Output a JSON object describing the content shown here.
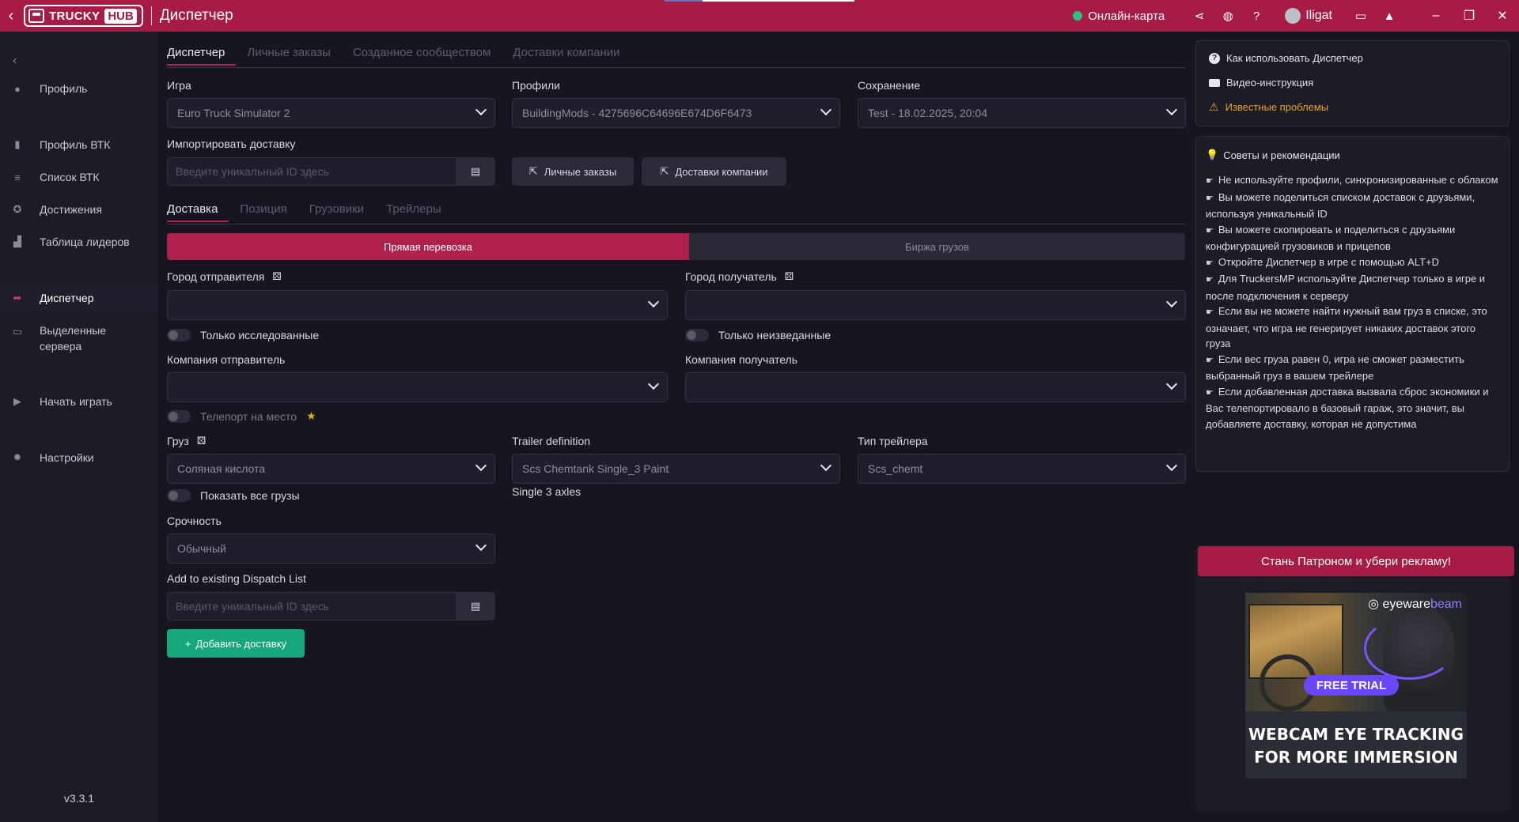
{
  "titlebar": {
    "brand_left": "TRUCKY",
    "brand_right": "HUB",
    "title": "Диспетчер",
    "online_label": "Онлайн-карта",
    "username": "Iligat"
  },
  "sidebar": {
    "items": [
      {
        "label": "Профиль",
        "icon": "user-icon"
      },
      {
        "label": "Профиль ВТК",
        "icon": "building-icon"
      },
      {
        "label": "Список ВТК",
        "icon": "database-icon"
      },
      {
        "label": "Достижения",
        "icon": "medal-icon"
      },
      {
        "label": "Таблица лидеров",
        "icon": "ranking-icon"
      },
      {
        "label": "Диспетчер",
        "icon": "dispatch-icon"
      },
      {
        "label": "Выделенные сервера",
        "icon": "server-icon"
      },
      {
        "label": "Начать играть",
        "icon": "play-icon"
      },
      {
        "label": "Настройки",
        "icon": "gear-icon"
      }
    ],
    "version": "v3.3.1"
  },
  "top_tabs": [
    "Диспетчер",
    "Личные заказы",
    "Созданное сообществом",
    "Доставки компании"
  ],
  "fields": {
    "game_label": "Игра",
    "game_value": "Euro Truck Simulator 2",
    "profiles_label": "Профили",
    "profiles_value": "BuildingMods - 4275696C64696E674D6F6473",
    "save_label": "Сохранение",
    "save_value": "Test - 18.02.2025, 20:04",
    "import_label": "Импортировать доставку",
    "import_placeholder": "Введите уникальный ID здесь",
    "personal_orders_btn": "Личные заказы",
    "company_deliveries_btn": "Доставки компании"
  },
  "sub_tabs": [
    "Доставка",
    "Позиция",
    "Грузовики",
    "Трейлеры"
  ],
  "segment": {
    "on": "Прямая перевозка",
    "off": "Биржа грузов"
  },
  "delivery": {
    "from_city_label": "Город отправителя",
    "to_city_label": "Город получатель",
    "only_explored": "Только исследованные",
    "only_unexplored": "Только неизведанные",
    "from_company_label": "Компания отправитель",
    "to_company_label": "Компания получатель",
    "teleport": "Телепорт на место",
    "cargo_label": "Груз",
    "cargo_value": "Соляная кислота",
    "trailer_def_label": "Trailer definition",
    "trailer_def_value": "Scs Chemtank Single_3 Paint",
    "trailer_def_note": "Single 3 axles",
    "trailer_type_label": "Тип трейлера",
    "trailer_type_value": "Scs_chemt",
    "show_all_cargo": "Показать все грузы",
    "urgency_label": "Срочность",
    "urgency_value": "Обычный",
    "dispatch_list_label": "Add to existing Dispatch List",
    "dispatch_list_placeholder": "Введите уникальный ID здесь",
    "add_button": "Добавить доставку"
  },
  "help": {
    "how_to": "Как использовать Диспетчер",
    "video": "Видео-инструкция",
    "known_issues": "Известные проблемы"
  },
  "tips": {
    "title": "Советы и рекомендации",
    "items": [
      "Не используйте профили, синхронизированные с облаком",
      "Вы можете поделиться списком доставок с друзьями, используя уникальный ID",
      "Вы можете скопировать и поделиться с друзьями конфигурацией грузовиков и прицепов",
      "Откройте Диспетчер в игре с помощью ALT+D",
      "Для TruckersMP используйте Диспетчер только в игре и после подключения к серверу",
      "Если вы не можете найти нужный вам груз в списке, это означает, что игра не генерирует никаких доставок этого груза",
      "Если вес груза равен 0, игра не сможет разместить выбранный груз в вашем трейлере",
      "Если добавленная доставка вызвала сброс экономики и Вас телепортировало в базовый гараж, это значит, вы добавляете доставку, которая не допустима"
    ]
  },
  "patron": "Стань Патроном и убери рекламу!",
  "ad": {
    "brand_a": "eyeware",
    "brand_b": "beam",
    "cta": "FREE TRIAL",
    "line1": "WEBCAM EYE TRACKING",
    "line2": "FOR MORE IMMERSION"
  },
  "colors": {
    "accent": "#a61c45",
    "success": "#16a77b",
    "online": "#2ec27e",
    "warning": "#e0a52a"
  }
}
